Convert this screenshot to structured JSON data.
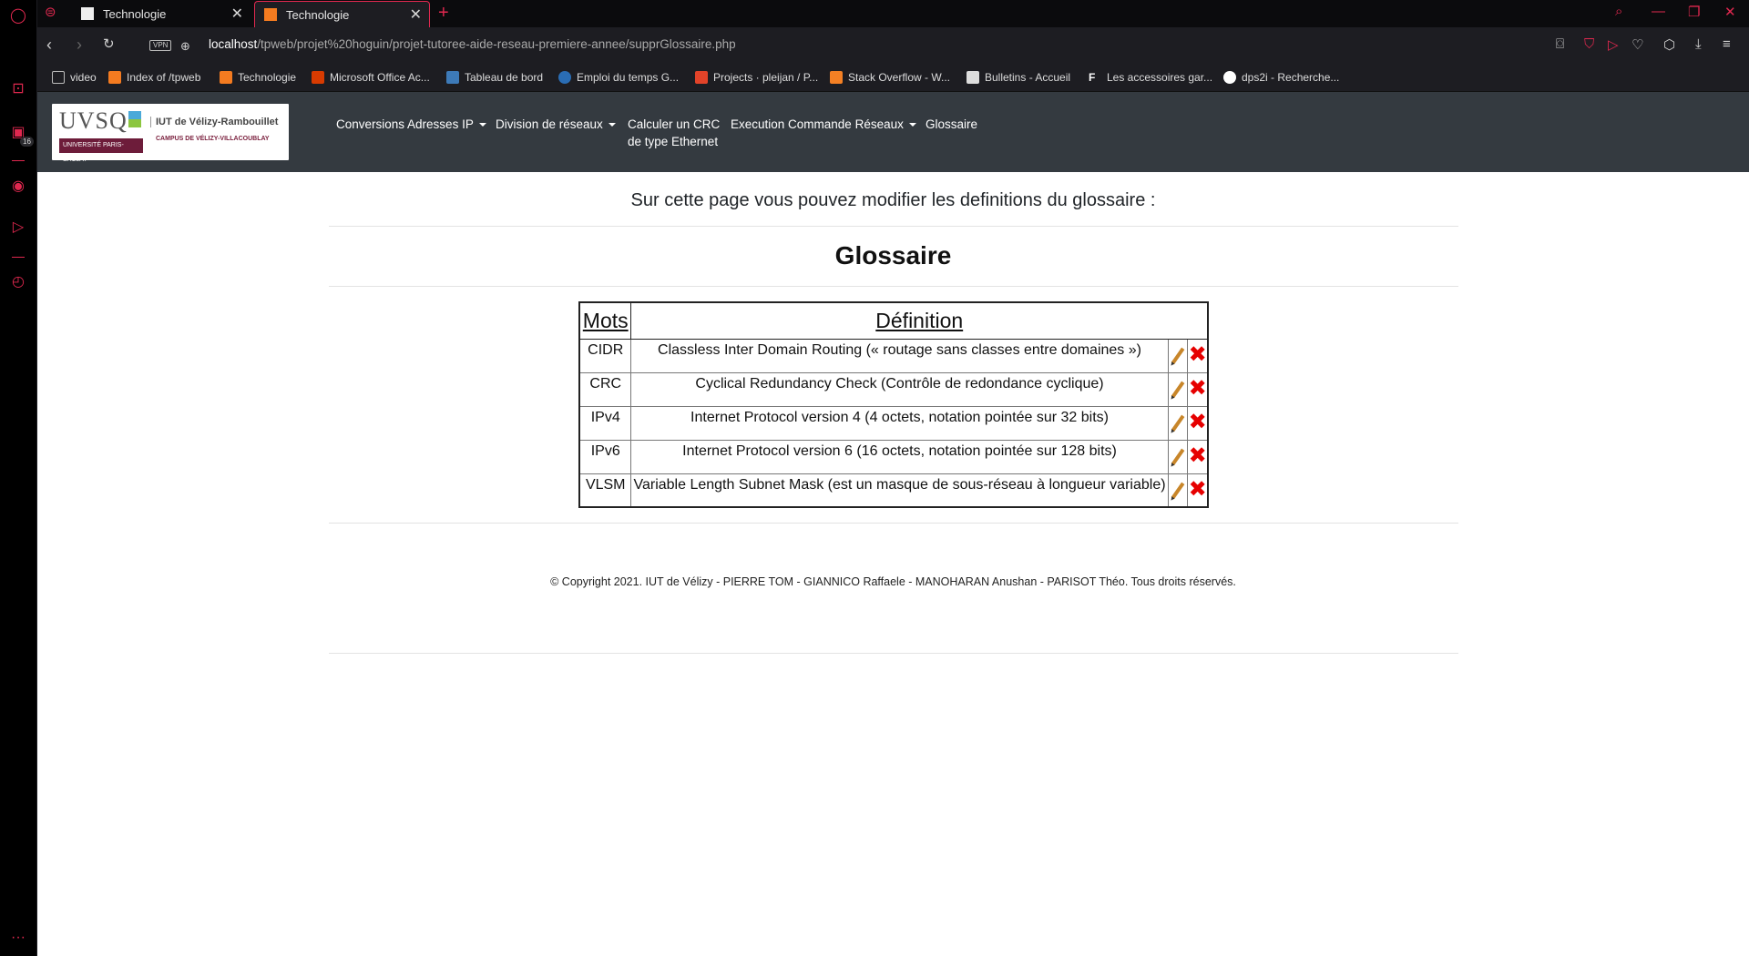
{
  "tabs": [
    {
      "title": "Technologie",
      "active": false
    },
    {
      "title": "Technologie",
      "active": true
    }
  ],
  "address": {
    "host": "localhost",
    "path": "/tpweb/projet%20hoguin/projet-tutoree-aide-reseau-premiere-annee/supprGlossaire.php",
    "vpn_label": "VPN"
  },
  "sidebar": {
    "badge": "16"
  },
  "bookmarks": [
    {
      "label": "video",
      "color": "#888888"
    },
    {
      "label": "Index of /tpweb",
      "color": "#f47b20"
    },
    {
      "label": "Technologie",
      "color": "#f47b20"
    },
    {
      "label": "Microsoft Office Ac...",
      "color": "#d83b01"
    },
    {
      "label": "Tableau de bord",
      "color": "#3d7ab8"
    },
    {
      "label": "Emploi du temps G...",
      "color": "#2a6db5"
    },
    {
      "label": "Projects · pleijan / P...",
      "color": "#e24329"
    },
    {
      "label": "Stack Overflow - W...",
      "color": "#f48024"
    },
    {
      "label": "Bulletins - Accueil",
      "color": "#dddddd"
    },
    {
      "label": "Les accessoires gar...",
      "color": "#ffffff"
    },
    {
      "label": "dps2i - Recherche...",
      "color": "#4285f4"
    }
  ],
  "site": {
    "logo": {
      "name": "UVSQ",
      "university": "UNIVERSITÉ PARIS-SACLAY",
      "iut": "IUT de Vélizy-Rambouillet",
      "campus": "CAMPUS DE VÉLIZY-VILLACOUBLAY"
    },
    "menu": {
      "conversions": "Conversions Adresses IP",
      "division": "Division de réseaux",
      "crc_line1": "Calculer un CRC",
      "crc_line2": "de type Ethernet",
      "execution": "Execution Commande Réseaux",
      "glossaire": "Glossaire"
    },
    "intro": "Sur cette page vous pouvez modifier les definitions du glossaire :",
    "title": "Glossaire",
    "table": {
      "headers": {
        "mots": "Mots",
        "definition": "Définition"
      },
      "rows": [
        {
          "mot": "CIDR",
          "def": "Classless Inter Domain Routing (« routage sans classes entre domaines »)"
        },
        {
          "mot": "CRC",
          "def": "Cyclical Redundancy Check (Contrôle de redondance cyclique)"
        },
        {
          "mot": "IPv4",
          "def": "Internet Protocol version 4 (4 octets, notation pointée sur 32 bits)"
        },
        {
          "mot": "IPv6",
          "def": "Internet Protocol version 6 (16 octets, notation pointée sur 128 bits)"
        },
        {
          "mot": "VLSM",
          "def": "Variable Length Subnet Mask (est un masque de sous-réseau à longueur variable)"
        }
      ]
    },
    "footer": "© Copyright 2021. IUT de Vélizy - PIERRE TOM - GIANNICO Raffaele - MANOHARAN Anushan - PARISOT Théo. Tous droits réservés."
  }
}
